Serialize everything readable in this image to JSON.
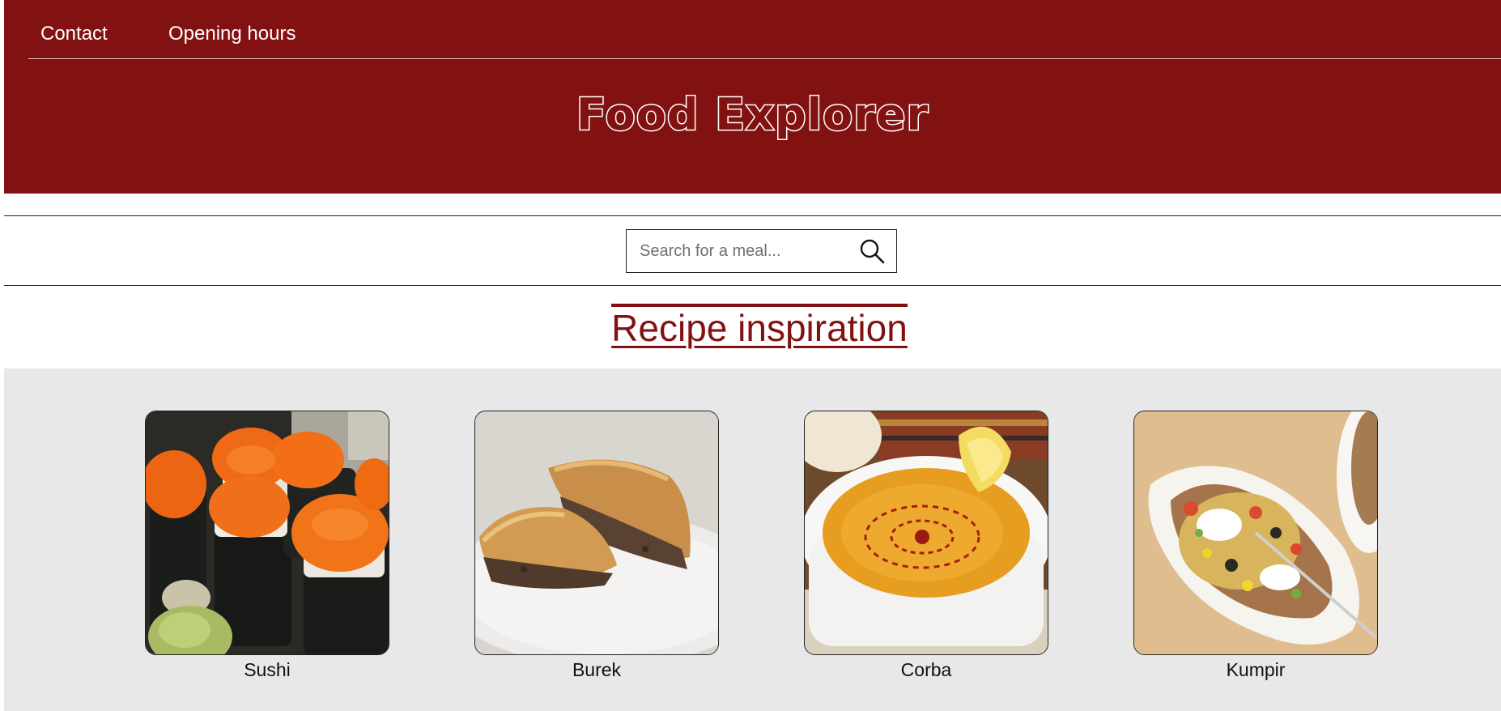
{
  "nav": {
    "contact": "Contact",
    "opening_hours": "Opening hours"
  },
  "brand": {
    "title": "Food Explorer"
  },
  "search": {
    "placeholder": "Search for a meal...",
    "value": "",
    "icon": "search-icon"
  },
  "section": {
    "title": "Recipe inspiration"
  },
  "recipes": [
    {
      "name": "Sushi",
      "image": "sushi-photo"
    },
    {
      "name": "Burek",
      "image": "burek-photo"
    },
    {
      "name": "Corba",
      "image": "corba-soup-photo"
    },
    {
      "name": "Kumpir",
      "image": "kumpir-photo"
    }
  ],
  "colors": {
    "brand": "#821212",
    "gallery_bg": "#e8e8e8",
    "text": "#111111"
  }
}
